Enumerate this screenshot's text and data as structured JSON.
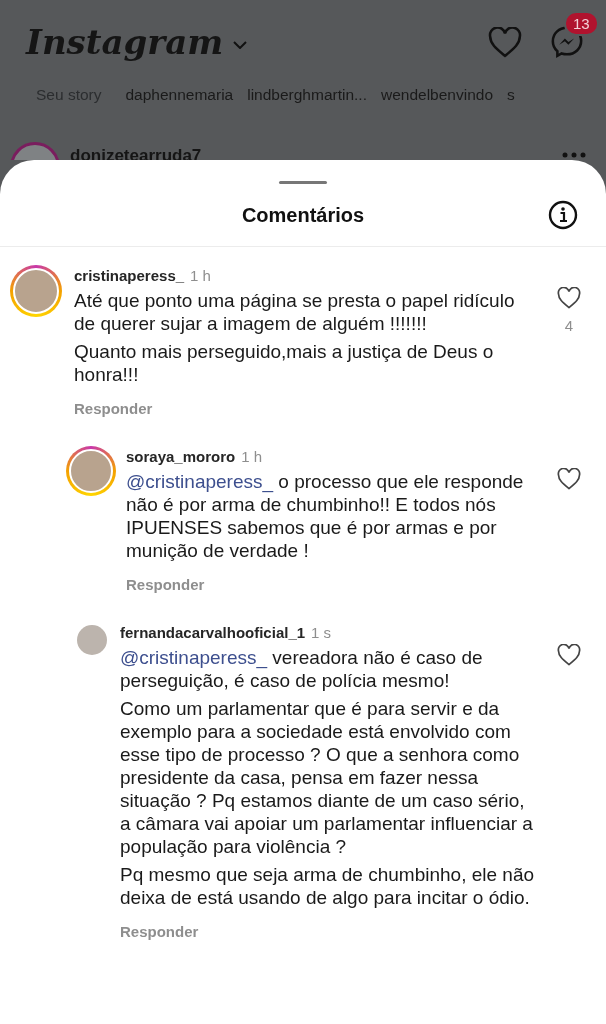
{
  "header": {
    "logo": "Instagram",
    "message_badge": "13"
  },
  "stories": [
    {
      "name": "Seu story",
      "own": true
    },
    {
      "name": "daphennemaria",
      "own": false
    },
    {
      "name": "lindberghmartin...",
      "own": false
    },
    {
      "name": "wendelbenvindo",
      "own": false
    },
    {
      "name": "s",
      "own": false
    }
  ],
  "post": {
    "username": "donizetearruda7"
  },
  "sheet": {
    "title": "Comentários"
  },
  "comments": [
    {
      "username": "cristinaperess_",
      "time": "1 h",
      "reply": false,
      "story_ring": true,
      "paragraphs": [
        "Até que ponto uma página se presta o papel ridículo de querer sujar a imagem de alguém !!!!!!!",
        "Quanto mais perseguido,mais a justiça de Deus o honra!!!"
      ],
      "likes": "4",
      "action": "Responder"
    },
    {
      "username": "soraya_mororo",
      "time": "1 h",
      "reply": true,
      "story_ring": true,
      "mention": "@cristinaperess_",
      "paragraphs": [
        "o processo que ele responde não é por arma de chumbinho!! E todos nós IPUENSES sabemos que é por armas e por munição de verdade !"
      ],
      "action": "Responder"
    },
    {
      "username": "fernandacarvalhooficial_1",
      "time": "1 s",
      "reply": true,
      "story_ring": false,
      "mention": "@cristinaperess_",
      "paragraphs": [
        " vereadora não é caso de perseguição, é caso de polícia mesmo!",
        "Como um parlamentar que é para servir e da exemplo para a sociedade está envolvido com esse tipo de processo ? O que a senhora como presidente da casa, pensa em fazer nessa situação ? Pq estamos diante de um caso sério, a câmara vai apoiar um parlamentar influenciar a população para violência ?",
        "Pq mesmo que seja arma de chumbinho, ele não deixa de está usando de algo para incitar o ódio."
      ],
      "action": "Responder"
    }
  ]
}
